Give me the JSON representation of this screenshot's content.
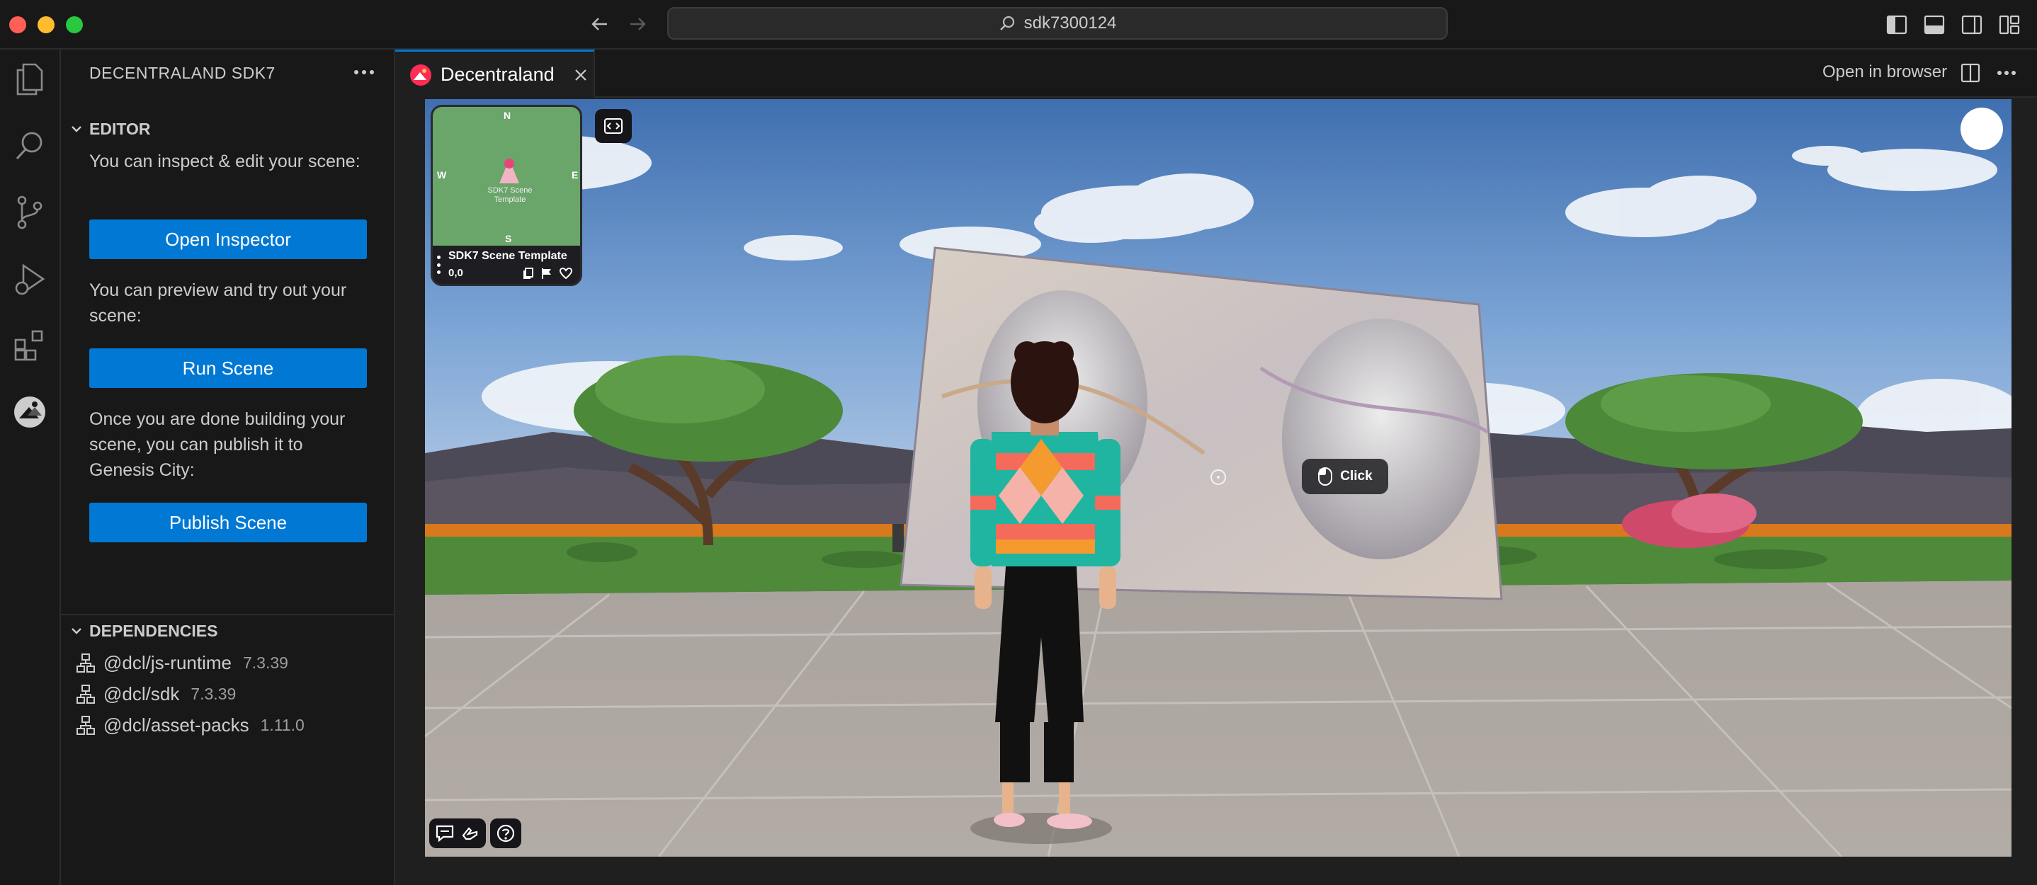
{
  "titlebar": {
    "search_text": "sdk7300124"
  },
  "sidebar": {
    "title": "DECENTRALAND SDK7",
    "editor_section": {
      "title": "EDITOR",
      "inspect_text": "You can inspect & edit your scene:",
      "open_inspector_label": "Open Inspector",
      "preview_text": "You can preview and try out your scene:",
      "run_scene_label": "Run Scene",
      "publish_text": "Once you are done building your scene, you can publish it to Genesis City:",
      "publish_scene_label": "Publish Scene"
    },
    "dependencies_section": {
      "title": "DEPENDENCIES",
      "items": [
        {
          "name": "@dcl/js-runtime",
          "version": "7.3.39"
        },
        {
          "name": "@dcl/sdk",
          "version": "7.3.39"
        },
        {
          "name": "@dcl/asset-packs",
          "version": "1.11.0"
        }
      ]
    }
  },
  "editor": {
    "tab_label": "Decentraland",
    "open_in_browser_label": "Open in browser"
  },
  "scene": {
    "minimap": {
      "north": "N",
      "south": "S",
      "east": "E",
      "west": "W",
      "scene_label": "SDK7 Scene Template",
      "scene_title": "SDK7 Scene Template",
      "coords": "0,0"
    },
    "click_tooltip": "Click"
  },
  "colors": {
    "accent": "#0078d4",
    "background": "#1f1f1f",
    "sidebar": "#181818"
  }
}
